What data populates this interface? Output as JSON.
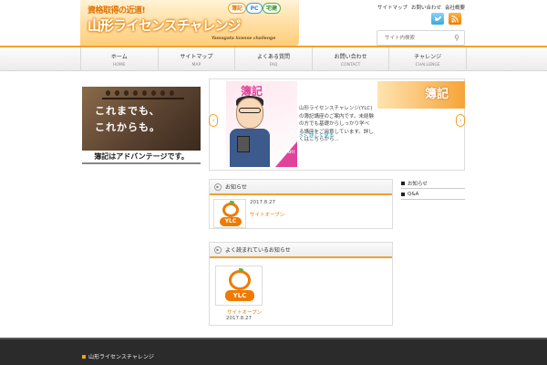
{
  "header": {
    "catch_copy": "資格取得の近道!",
    "logo_title": "山形ライセンスチャレンジ",
    "logo_subtitle": "Yamagata license challenge",
    "categories": [
      "簿記",
      "PC",
      "宅建"
    ],
    "top_links": [
      "サイトマップ",
      "お問い合わせ",
      "会社概要"
    ],
    "search": {
      "placeholder": "サイト内検索"
    }
  },
  "nav": {
    "items": [
      {
        "jp": "ホーム",
        "en": "HOME"
      },
      {
        "jp": "サイトマップ",
        "en": "MAP"
      },
      {
        "jp": "よくある質問",
        "en": "FAQ"
      },
      {
        "jp": "お問い合わせ",
        "en": "CONTACT"
      },
      {
        "jp": "チャレンジ",
        "en": "CHALLENGE"
      }
    ]
  },
  "banner": {
    "line1": "これまでも、",
    "line2": "これからも。",
    "caption": "簿記はアドバンテージです。"
  },
  "slider": {
    "badge_left": "簿記",
    "badge_right": "簿記",
    "go_label": "GO!!",
    "text": "山形ライセンスチャレンジ(YLC)の簿記講座のご案内です。未経験の方でも基礎からしっかり学べる講座をご用意しています。詳しくはこちらから...",
    "more": ">> 詳しく見る"
  },
  "news": {
    "title": "お知らせ",
    "date": "2017.8.27",
    "item_title": "サイトオープン",
    "logo_text": "YLC"
  },
  "ranking": {
    "title": "よく読まれているお知らせ",
    "item_title": "サイトオープン",
    "date": "2017.8.27",
    "logo_text": "YLC"
  },
  "sidebar": {
    "items": [
      "お知らせ",
      "Q&A"
    ]
  },
  "footer": {
    "title": "山形ライセンスチャレンジ"
  },
  "colors": {
    "accent": "#f2a030",
    "link_orange": "#f07a00",
    "link_blue": "#2aa0c0"
  },
  "icons": {
    "twitter": "twitter-icon",
    "rss": "rss-icon",
    "search": "search-icon"
  }
}
